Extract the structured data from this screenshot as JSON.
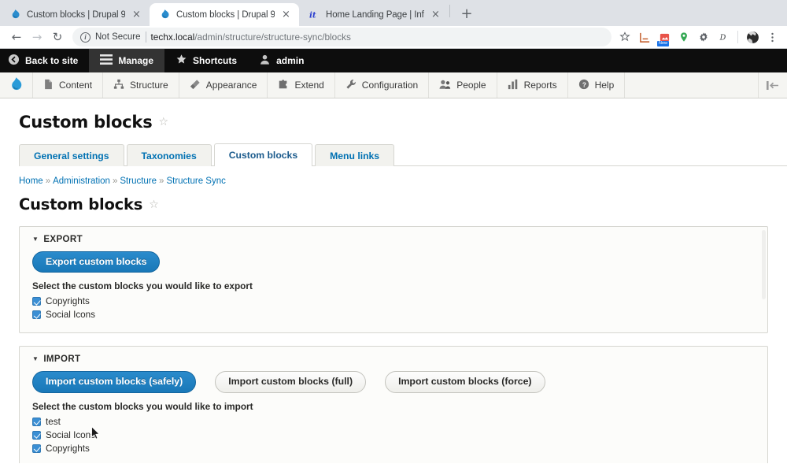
{
  "browser": {
    "tabs": [
      {
        "title": "Custom blocks | Drupal 9",
        "favicon": "drupal-icon",
        "active": false,
        "close_label": "×"
      },
      {
        "title": "Custom blocks | Drupal 9",
        "favicon": "drupal-icon",
        "active": true,
        "close_label": "×"
      },
      {
        "title": "Home Landing Page | Informat",
        "favicon": "it-icon",
        "active": false,
        "close_label": "×"
      }
    ],
    "new_tab_label": "+",
    "nav": {
      "back": "←",
      "forward": "→",
      "reload": "↻"
    },
    "omnibox": {
      "info_icon": "info-circle-icon",
      "security_label": "Not Secure",
      "url_host": "techx.local",
      "url_path": "/admin/structure/structure-sync/blocks"
    },
    "omni_icons": [
      "bookmark-star-icon",
      "chart-extension-icon",
      "image-extension-icon",
      "location-pin-icon",
      "gear-extension-icon",
      "d-extension-icon",
      "profile-avatar-icon",
      "kebab-menu-icon"
    ],
    "extension_badge": "New"
  },
  "drupal_toolbar": {
    "items": [
      {
        "label": "Back to site",
        "icon": "back-arrow-icon",
        "active": false
      },
      {
        "label": "Manage",
        "icon": "hamburger-icon",
        "active": true
      },
      {
        "label": "Shortcuts",
        "icon": "star-icon",
        "active": false
      },
      {
        "label": "admin",
        "icon": "user-icon",
        "active": false
      }
    ]
  },
  "drupal_menu": {
    "logo": "drupal-drop-logo",
    "items": [
      {
        "label": "Content",
        "icon": "file-icon"
      },
      {
        "label": "Structure",
        "icon": "sitemap-icon"
      },
      {
        "label": "Appearance",
        "icon": "paintbrush-icon"
      },
      {
        "label": "Extend",
        "icon": "puzzle-icon"
      },
      {
        "label": "Configuration",
        "icon": "wrench-icon"
      },
      {
        "label": "People",
        "icon": "people-icon"
      },
      {
        "label": "Reports",
        "icon": "bars-chart-icon"
      },
      {
        "label": "Help",
        "icon": "question-circle-icon"
      }
    ],
    "collapse_icon": "collapse-toolbar-icon"
  },
  "page": {
    "title": "Custom blocks",
    "title_star": "☆",
    "tabs": [
      {
        "label": "General settings",
        "active": false
      },
      {
        "label": "Taxonomies",
        "active": false
      },
      {
        "label": "Custom blocks",
        "active": true
      },
      {
        "label": "Menu links",
        "active": false
      }
    ],
    "breadcrumb": [
      {
        "label": "Home"
      },
      {
        "label": "Administration"
      },
      {
        "label": "Structure"
      },
      {
        "label": "Structure Sync"
      }
    ],
    "breadcrumb_separator": "»",
    "section_title": "Custom blocks",
    "section_star": "☆"
  },
  "export": {
    "summary": "EXPORT",
    "triangle": "▼",
    "button": "Export custom blocks",
    "select_label": "Select the custom blocks you would like to export",
    "items": [
      {
        "label": "Copyrights",
        "checked": true
      },
      {
        "label": "Social Icons",
        "checked": true
      }
    ]
  },
  "import": {
    "summary": "IMPORT",
    "triangle": "▼",
    "buttons": [
      {
        "label": "Import custom blocks (safely)",
        "style": "primary"
      },
      {
        "label": "Import custom blocks (full)",
        "style": "secondary"
      },
      {
        "label": "Import custom blocks (force)",
        "style": "secondary"
      }
    ],
    "select_label": "Select the custom blocks you would like to import",
    "items": [
      {
        "label": "test",
        "checked": true
      },
      {
        "label": "Social Icons",
        "checked": true
      },
      {
        "label": "Copyrights",
        "checked": true
      }
    ]
  },
  "colors": {
    "drupal_blue": "#0071b3",
    "button_blue": "#1978b8",
    "toolbar_black": "#0d0d0d",
    "checkbox_blue": "#3b8fd4"
  }
}
